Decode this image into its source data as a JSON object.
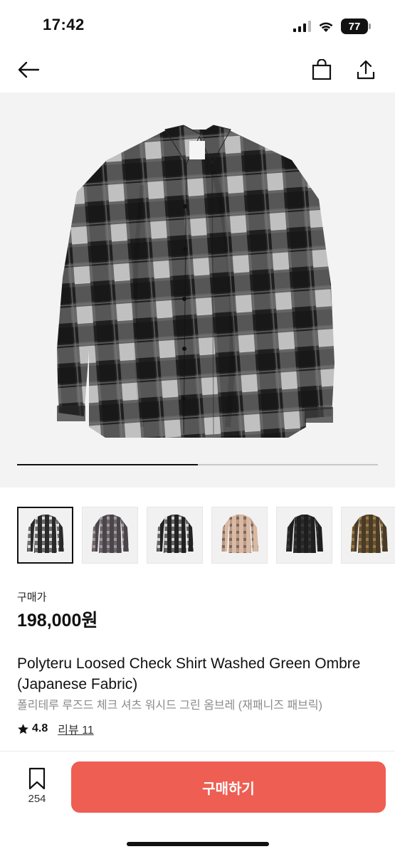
{
  "status_bar": {
    "time": "17:42",
    "battery": "77"
  },
  "product": {
    "price_label": "구매가",
    "price": "198,000원",
    "title_en": "Polyteru Loosed Check Shirt Washed Green Ombre (Japanese Fabric)",
    "title_ko": "폴리테루 루즈드 체크 셔츠 워시드 그린 옴브레 (재패니즈 패브릭)",
    "rating": "4.8",
    "reviews": "리뷰 11"
  },
  "gallery": {
    "progress": 0.5,
    "thumbnails": [
      {
        "name": "thumb-black-white-check",
        "color": "#2a2a2a",
        "accent": "#e8e8e8"
      },
      {
        "name": "thumb-grey-check",
        "color": "#4a4548",
        "accent": "#a89da2"
      },
      {
        "name": "thumb-black-white-check-2",
        "color": "#222222",
        "accent": "#dcdcdc"
      },
      {
        "name": "thumb-beige-check",
        "color": "#d9b9a2",
        "accent": "#7a6257"
      },
      {
        "name": "thumb-black-solid",
        "color": "#1e1e1e",
        "accent": "#3a3a3a"
      },
      {
        "name": "thumb-olive-check",
        "color": "#4a3b26",
        "accent": "#a07d4a"
      }
    ]
  },
  "bottom_bar": {
    "wish_count": "254",
    "buy_label": "구매하기"
  },
  "colors": {
    "buy_button": "#ee5e52",
    "text": "#111111",
    "muted": "#8a8a8a"
  },
  "icons": {
    "back": "arrow-left-icon",
    "cart": "shopping-bag-icon",
    "share": "share-icon",
    "wish": "bookmark-icon",
    "star": "star-icon"
  }
}
